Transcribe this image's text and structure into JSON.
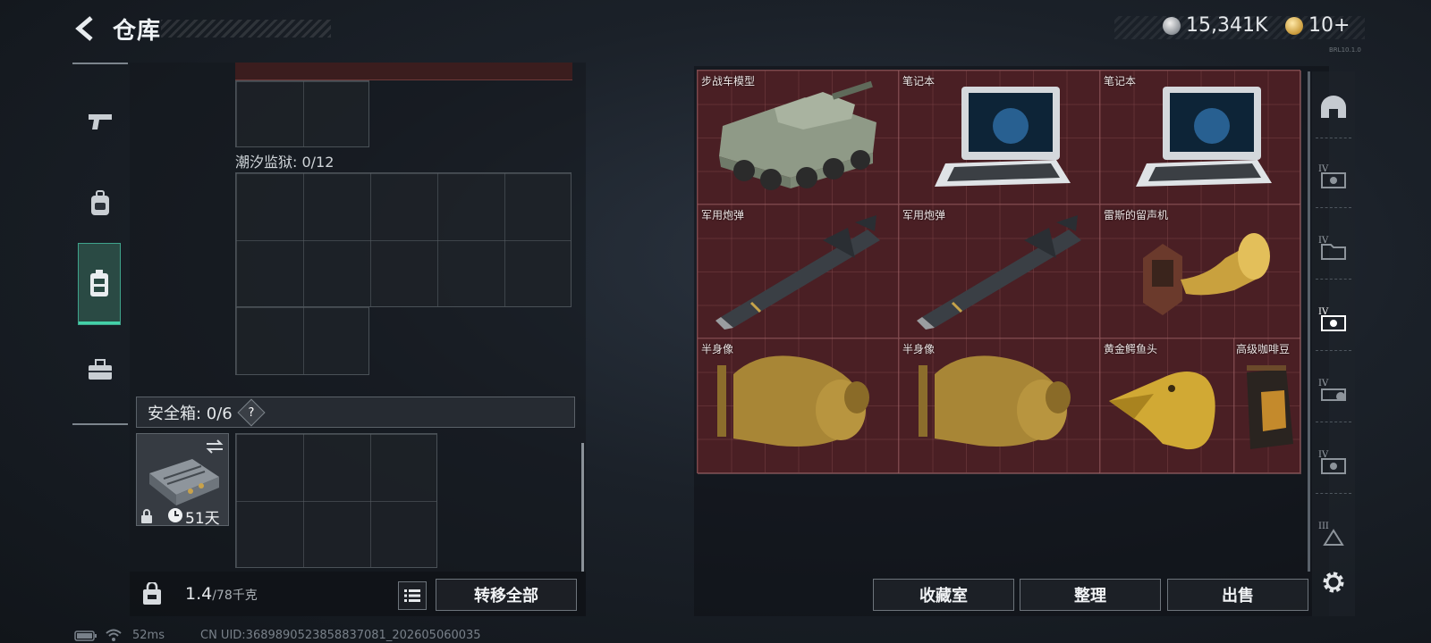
{
  "header": {
    "title": "仓库",
    "currency_silver": "15,341K",
    "currency_gold": "10+",
    "version_tag": "BRL10.1.0"
  },
  "left_nav": {
    "items": [
      "weapon",
      "backpack",
      "rig",
      "toolbox"
    ],
    "active": "rig"
  },
  "inventory": {
    "prison_label": "潮汐监狱: 0/12",
    "safe_box_label": "安全箱: 0/6",
    "safe_box_help": "?",
    "case_days": "51天",
    "weight_current": "1.4",
    "weight_max": "/78千克",
    "transfer_all_label": "转移全部"
  },
  "stash": {
    "items": [
      {
        "name": "步战车模型"
      },
      {
        "name": "笔记本"
      },
      {
        "name": "笔记本"
      },
      {
        "name": "军用炮弹"
      },
      {
        "name": "军用炮弹"
      },
      {
        "name": "雷斯的留声机"
      },
      {
        "name": "半身像"
      },
      {
        "name": "半身像"
      },
      {
        "name": "黄金鳄鱼头"
      },
      {
        "name": "高级咖啡豆"
      }
    ],
    "collection_label": "收藏室",
    "sort_label": "整理",
    "sell_label": "出售"
  },
  "side_tabs": [
    "helmet",
    "IV",
    "IV",
    "IV",
    "IV",
    "IV",
    "III"
  ],
  "status_bar": {
    "ping": "52ms",
    "uid": "CN UID:3689890523858837081_202605060035"
  },
  "colors": {
    "accent_green": "#43d1a8",
    "stash_red": "#4a1f24"
  }
}
